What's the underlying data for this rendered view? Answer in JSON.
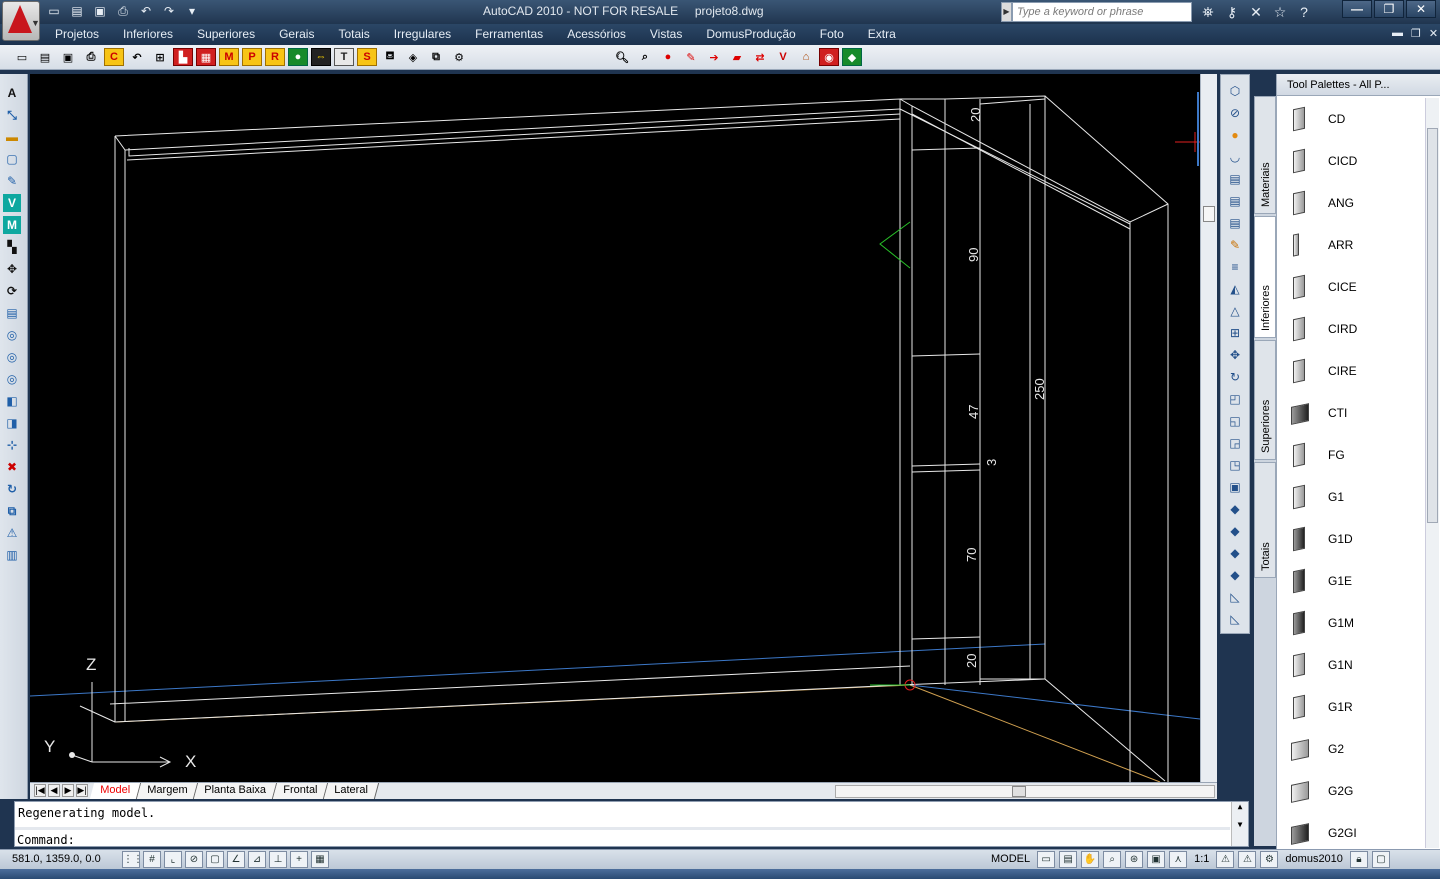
{
  "title_bar": {
    "app_title": "AutoCAD 2010 - NOT FOR RESALE",
    "file_name": "projeto8.dwg",
    "search_placeholder": "Type a keyword or phrase",
    "window_controls": [
      "—",
      "❐",
      "✕"
    ]
  },
  "quick_access": [
    "new-icon",
    "open-icon",
    "save-icon",
    "print-icon",
    "undo-icon",
    "redo-icon"
  ],
  "menu": {
    "items": [
      "Projetos",
      "Inferiores",
      "Superiores",
      "Gerais",
      "Totais",
      "Irregulares",
      "Ferramentas",
      "Acessórios",
      "Vistas",
      "DomusProdução",
      "Foto",
      "Extra"
    ]
  },
  "toolbar": {
    "letters": [
      "M",
      "P",
      "R",
      "T",
      "S",
      "V"
    ]
  },
  "left_toolbar": {
    "letters": [
      "A",
      "V",
      "M"
    ]
  },
  "drawing": {
    "dimensions": [
      "20",
      "90",
      "47",
      "3",
      "70",
      "20",
      "250"
    ],
    "ucs": {
      "z": "Z",
      "y": "Y",
      "x": "X"
    }
  },
  "layout_tabs": [
    "Model",
    "Margem",
    "Planta Baixa",
    "Frontal",
    "Lateral"
  ],
  "command": {
    "history": "Regenerating model.",
    "prompt": "Command:"
  },
  "status_bar": {
    "coordinates": "581.0, 1359.0, 0.0",
    "model_label": "MODEL",
    "annotation_scale": "1:1",
    "workspace": "domus2010"
  },
  "tool_palette": {
    "header": "Tool Palettes - All P...",
    "tabs": [
      "Materiais",
      "Inferiores",
      "Superiores",
      "Totais"
    ],
    "active_tab": "Inferiores",
    "items": [
      "CD",
      "CICD",
      "ANG",
      "ARR",
      "CICE",
      "CIRD",
      "CIRE",
      "CTI",
      "FG",
      "G1",
      "G1D",
      "G1E",
      "G1M",
      "G1N",
      "G1R",
      "G2",
      "G2G",
      "G2GI"
    ]
  },
  "colors": {
    "canvas_bg": "#000000",
    "line_white": "#e8e8e8",
    "line_blue": "#3c78c8",
    "line_orange": "#d0a050",
    "accent_red": "#c8161d"
  }
}
